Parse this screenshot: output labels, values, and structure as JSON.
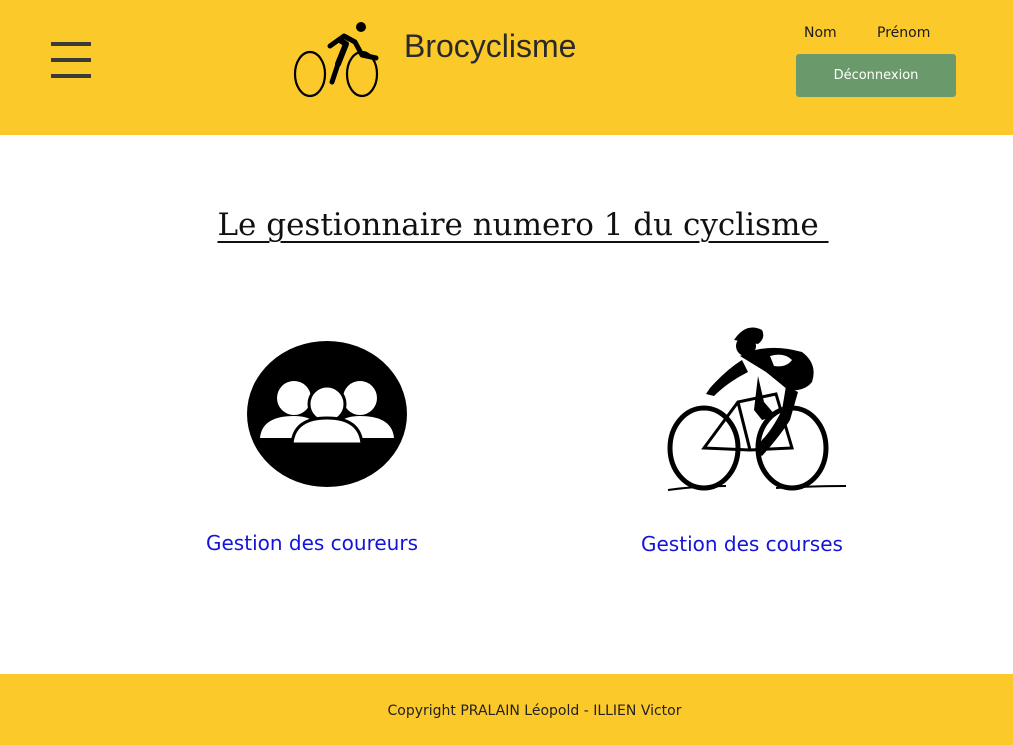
{
  "header": {
    "menu_icon": "hamburger-menu-icon",
    "logo_icon": "cyclist-logo-icon",
    "brand_name": "Brocyclisme",
    "user": {
      "last_name_label": "Nom",
      "first_name_label": "Prénom"
    },
    "logout_label": "Déconnexion"
  },
  "main": {
    "title": "Le gestionnaire numero 1 du cyclisme ",
    "cards": [
      {
        "icon": "group-users-icon",
        "label": "Gestion des coureurs"
      },
      {
        "icon": "racing-cyclist-icon",
        "label": "Gestion des courses"
      }
    ]
  },
  "footer": {
    "copyright": "Copyright PRALAIN Léopold - ILLIEN Victor"
  },
  "colors": {
    "header_bg": "#fcc92b",
    "footer_bg": "#fcc92b",
    "logout_bg": "#6a9a6b",
    "link": "#1414d8"
  }
}
